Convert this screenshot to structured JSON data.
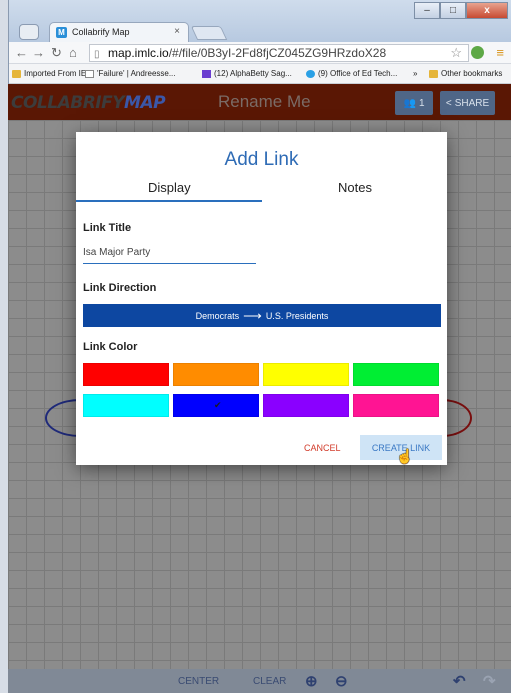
{
  "browser": {
    "tab_title": "Collabrify Map",
    "tab_favicon": "M",
    "tab_close": "×",
    "url_host": "map.imlc.io",
    "url_path": "/#/file/0B3yI-2Fd8fjCZ045ZG9HRzdoX28",
    "bookmarks": [
      {
        "label": "Imported From IE",
        "icon": "folder-icon"
      },
      {
        "label": "'Failure' | Andreesse...",
        "icon": "page-icon"
      },
      {
        "label": "(12) AlphaBetty Sag...",
        "icon": "alphabetty-icon"
      },
      {
        "label": "(9) Office of Ed Tech...",
        "icon": "twitter-icon"
      },
      {
        "label": "»",
        "icon": ""
      },
      {
        "label": "Other bookmarks",
        "icon": "folder-icon"
      }
    ]
  },
  "app": {
    "logo_part1": "COLLABRIFY",
    "logo_part2": "MAP",
    "doc_title": "Rename Me",
    "users_count": "1",
    "share_label": "SHARE",
    "footer": {
      "center_label": "CENTER",
      "clear_label": "CLEAR"
    }
  },
  "dialog": {
    "title": "Add Link",
    "tabs": [
      {
        "label": "Display",
        "active": true
      },
      {
        "label": "Notes",
        "active": false
      }
    ],
    "link_title_label": "Link Title",
    "link_title_value": "Isa Major Party",
    "link_direction_label": "Link Direction",
    "direction_from": "Democrats",
    "direction_to": "U.S. Presidents",
    "link_color_label": "Link Color",
    "colors": [
      {
        "name": "red",
        "hex": "#ff0000",
        "selected": false
      },
      {
        "name": "orange",
        "hex": "#ff8c00",
        "selected": false
      },
      {
        "name": "yellow",
        "hex": "#ffff00",
        "selected": false
      },
      {
        "name": "green",
        "hex": "#00ee33",
        "selected": false
      },
      {
        "name": "cyan",
        "hex": "#00ffff",
        "selected": false
      },
      {
        "name": "blue",
        "hex": "#0000ff",
        "selected": true
      },
      {
        "name": "purple",
        "hex": "#8a00ff",
        "selected": false
      },
      {
        "name": "pink",
        "hex": "#ff1493",
        "selected": false
      }
    ],
    "cancel_label": "CANCEL",
    "create_label": "CREATE LINK"
  },
  "accent": "#2e6bb5"
}
